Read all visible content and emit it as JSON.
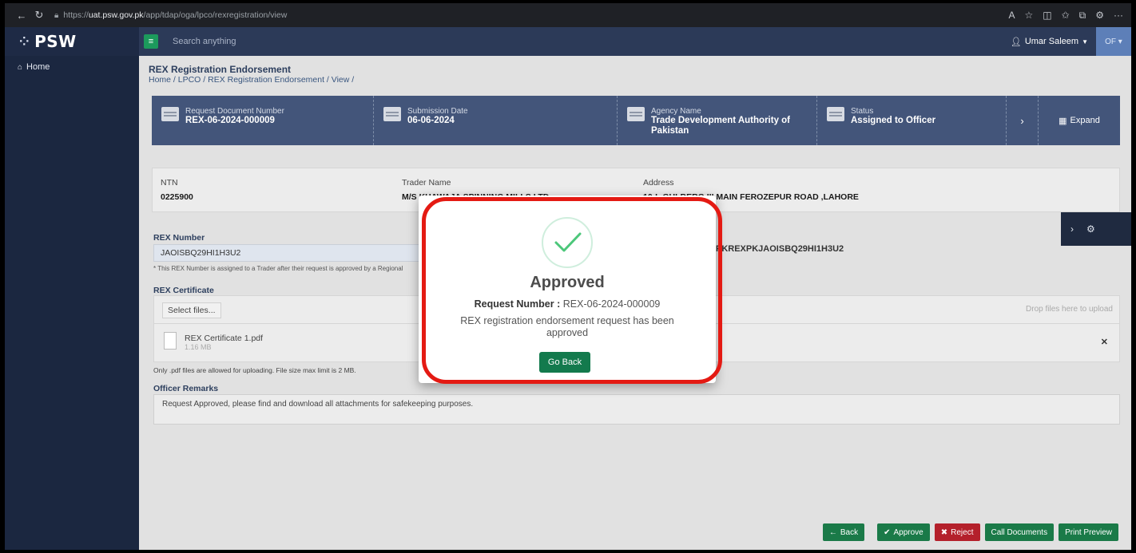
{
  "browser": {
    "url_prefix": "https://",
    "url_host": "uat.psw.gov.pk",
    "url_path": "/app/tdap/oga/lpco/rexregistration/view"
  },
  "sidebar": {
    "logo": "PSW",
    "home_label": "Home"
  },
  "topbar": {
    "search_placeholder": "Search anything",
    "user_name": "Umar Saleem",
    "user_initials": "OF"
  },
  "page": {
    "title": "REX Registration Endorsement",
    "breadcrumb": "Home / LPCO / REX Registration Endorsement / View /"
  },
  "info_strip": {
    "request_label": "Request Document Number",
    "request_value": "REX-06-2024-000009",
    "submission_label": "Submission Date",
    "submission_value": "06-06-2024",
    "agency_label": "Agency Name",
    "agency_value": "Trade Development Authority of Pakistan",
    "status_label": "Status",
    "status_value": "Assigned to Officer",
    "expand_label": "Expand"
  },
  "trader": {
    "ntn_label": "NTN",
    "ntn_value": "0225900",
    "name_label": "Trader Name",
    "name_value": "M/S KHAWAJA SPINNING MILLS LTD",
    "address_label": "Address",
    "address_value": "10-L GULBERG III MAIN FEROZEPUR ROAD ,LAHORE"
  },
  "rex": {
    "label": "REX Number",
    "value": "JAOISBQ29HI1H3U2",
    "full_value": "PKREXPKJAOISBQ29HI1H3U2",
    "hint": "* This REX Number is assigned to a Trader after their request is approved by a Regional"
  },
  "certificate": {
    "label": "REX Certificate",
    "select_files": "Select files...",
    "drop_text": "Drop files here to upload",
    "file_name": "REX Certificate 1.pdf",
    "file_size": "1.16 MB",
    "only_pdf": "Only .pdf files are allowed for uploading. File size max limit is 2 MB."
  },
  "remarks": {
    "label": "Officer Remarks",
    "value": "Request Approved, please find and download all attachments for safekeeping purposes."
  },
  "actions": {
    "back": "Back",
    "approve": "Approve",
    "reject": "Reject",
    "call_documents": "Call Documents",
    "print_preview": "Print Preview"
  },
  "modal": {
    "title": "Approved",
    "request_label": "Request Number :",
    "request_value": "REX-06-2024-000009",
    "message": "REX registration endorsement request has been approved",
    "go_back": "Go Back"
  },
  "colors": {
    "sidebar": "#1b2740",
    "strip": "#43557a",
    "primary_green": "#1a7a48",
    "reject_red": "#b4202b",
    "highlight": "#e41a13"
  }
}
